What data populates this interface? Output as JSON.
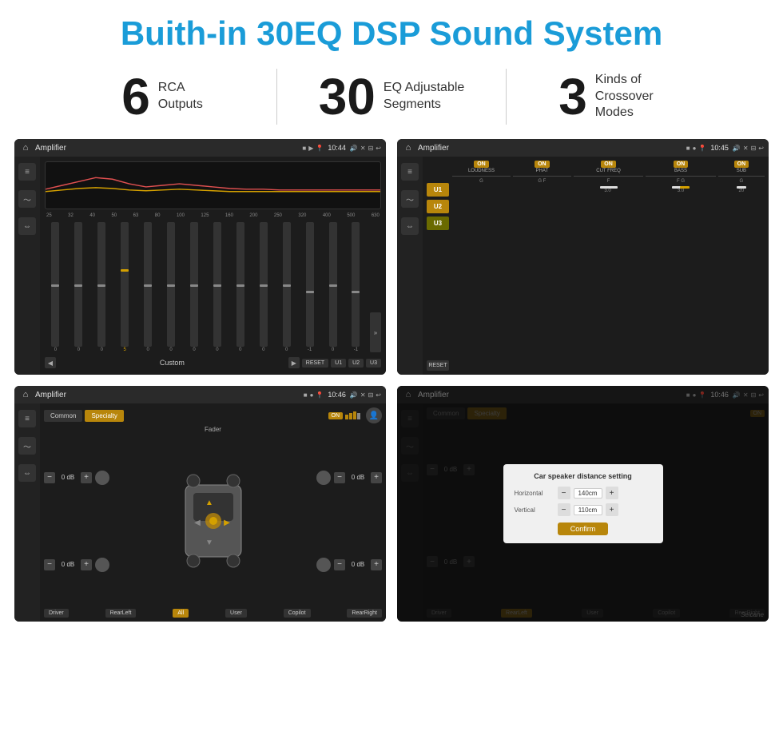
{
  "header": {
    "title": "Buith-in 30EQ DSP Sound System"
  },
  "stats": [
    {
      "number": "6",
      "label": "RCA\nOutputs"
    },
    {
      "number": "30",
      "label": "EQ Adjustable\nSegments"
    },
    {
      "number": "3",
      "label": "Kinds of\nCrossover Modes"
    }
  ],
  "screens": {
    "screen1": {
      "title": "Amplifier",
      "time": "10:44",
      "eq_freqs": [
        "25",
        "32",
        "40",
        "50",
        "63",
        "80",
        "100",
        "125",
        "160",
        "200",
        "250",
        "320",
        "400",
        "500",
        "630"
      ],
      "eq_values": [
        "0",
        "0",
        "0",
        "5",
        "0",
        "0",
        "0",
        "0",
        "0",
        "0",
        "0",
        "-1",
        "0",
        "-1"
      ],
      "preset_buttons": [
        "RESET",
        "U1",
        "U2",
        "U3"
      ],
      "custom_label": "Custom"
    },
    "screen2": {
      "title": "Amplifier",
      "time": "10:45",
      "u_buttons": [
        "U1",
        "U2",
        "U3"
      ],
      "toggles": [
        "LOUDNESS",
        "PHAT",
        "CUT FREQ",
        "BASS",
        "SUB"
      ],
      "reset_label": "RESET"
    },
    "screen3": {
      "title": "Amplifier",
      "time": "10:46",
      "tabs": [
        "Common",
        "Specialty"
      ],
      "fader_label": "Fader",
      "on_label": "ON",
      "channels": [
        "0 dB",
        "0 dB",
        "0 dB",
        "0 dB"
      ],
      "buttons": [
        "Driver",
        "RearLeft",
        "All",
        "User",
        "Copilot",
        "RearRight"
      ]
    },
    "screen4": {
      "title": "Amplifier",
      "time": "10:46",
      "tabs": [
        "Common",
        "Specialty"
      ],
      "dialog_title": "Car speaker distance setting",
      "horizontal_label": "Horizontal",
      "horizontal_value": "140cm",
      "vertical_label": "Vertical",
      "vertical_value": "110cm",
      "confirm_label": "Confirm",
      "channels_right": [
        "0 dB",
        "0 dB"
      ],
      "buttons": [
        "Driver",
        "RearLeft",
        "User",
        "Copilot",
        "RearRight"
      ],
      "watermark": "Seicane"
    }
  }
}
